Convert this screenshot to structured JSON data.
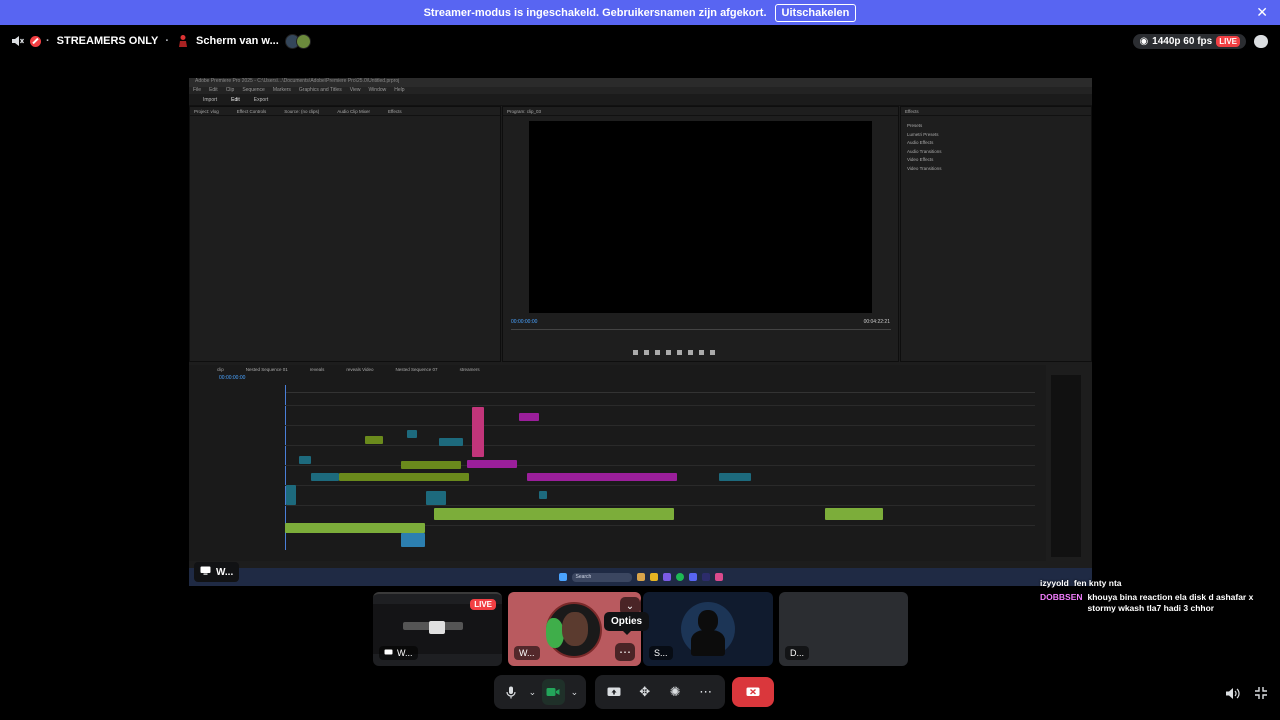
{
  "banner": {
    "message": "Streamer-modus is ingeschakeld. Gebruikersnamen zijn afgekort.",
    "button": "Uitschakelen",
    "close_glyph": "✕"
  },
  "topbar": {
    "channel": "STREAMERS ONLY",
    "separator": "·",
    "stream_title": "Scherm van w...",
    "quality": "1440p 60 fps",
    "live": "LIVE"
  },
  "screen_share": {
    "label": "W...",
    "premiere": {
      "title_text": "Adobe Premiere Pro 2025 - C:\\Users\\...\\Documents\\Adobe\\Premiere Pro\\25.0\\Untitled.prproj",
      "menu": [
        "File",
        "Edit",
        "Clip",
        "Sequence",
        "Markers",
        "Graphics and Titles",
        "View",
        "Window",
        "Help"
      ],
      "tabs": [
        "Import",
        "Edit",
        "Export"
      ],
      "left_panel_tabs": [
        "Project: vlog",
        "Effect Controls",
        "Source: (no clips)",
        "Audio Clip Mixer",
        "Effects"
      ],
      "program_label": "Program: clip_03",
      "program_tc_left": "00:00:00:00",
      "program_tc_right": "00:04:22:21",
      "timeline_tc": "00:00:00:00",
      "effects_title": "Effects",
      "effects_items": [
        "Presets",
        "Lumetri Presets",
        "Audio Effects",
        "Audio Transitions",
        "Video Effects",
        "Video Transitions"
      ],
      "timeline_tabs": [
        "clip",
        "Nested Sequence 01",
        "reveals",
        "reveals Video",
        "Nested Sequence 07",
        "streamers"
      ],
      "taskbar_search": "Search"
    }
  },
  "tiles": [
    {
      "label": "W...",
      "live": "LIVE"
    },
    {
      "label": "W..."
    },
    {
      "label": "S..."
    },
    {
      "label": "D..."
    }
  ],
  "tooltip": "Opties",
  "chat": [
    {
      "user": "izyyold",
      "user_color": "#ffffff",
      "text": "fen knty nta"
    },
    {
      "user": "DOBBSEN",
      "user_color": "#f47fff",
      "text": "khouya bina reaction ela disk d ashafar x stormy wkash tla7 hadi 3 chhor"
    }
  ],
  "icons": {
    "mic": "mic-icon",
    "camera": "camera-icon",
    "screen": "screen-share-icon",
    "activities": "activities-icon",
    "soundboard": "soundboard-icon",
    "more": "more-icon",
    "disconnect": "disconnect-icon",
    "volume": "volume-icon",
    "collapse": "collapse-icon"
  },
  "colors": {
    "banner": "#5865f2",
    "live": "#f23f43",
    "hangup": "#da373c",
    "camera_active": "#23a55a"
  }
}
